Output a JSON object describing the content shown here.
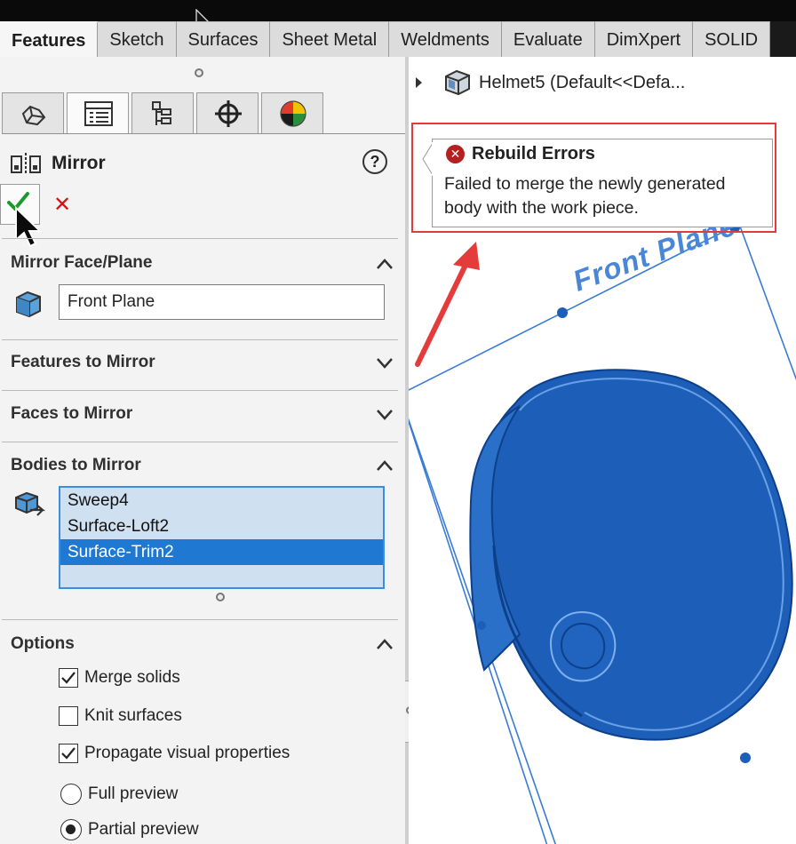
{
  "ribbon": {
    "tabs": [
      {
        "label": "Features",
        "active": true
      },
      {
        "label": "Sketch",
        "active": false
      },
      {
        "label": "Surfaces",
        "active": false
      },
      {
        "label": "Sheet Metal",
        "active": false
      },
      {
        "label": "Weldments",
        "active": false
      },
      {
        "label": "Evaluate",
        "active": false
      },
      {
        "label": "DimXpert",
        "active": false
      },
      {
        "label": "SOLID",
        "active": false
      }
    ]
  },
  "panel_tabs": [
    {
      "icon": "feature-manager-icon"
    },
    {
      "icon": "property-manager-icon"
    },
    {
      "icon": "configuration-manager-icon"
    },
    {
      "icon": "dimxpert-manager-icon"
    },
    {
      "icon": "display-manager-icon"
    }
  ],
  "property_manager": {
    "title": "Mirror",
    "help_label": "?",
    "ok_icon": "checkmark-icon",
    "cancel_label": "✕"
  },
  "sections": {
    "mirror_face_plane": {
      "title": "Mirror Face/Plane",
      "value": "Front Plane",
      "expanded": true
    },
    "features_to_mirror": {
      "title": "Features to Mirror",
      "expanded": false
    },
    "faces_to_mirror": {
      "title": "Faces to Mirror",
      "expanded": false
    },
    "bodies_to_mirror": {
      "title": "Bodies to Mirror",
      "expanded": true,
      "items": [
        "Sweep4",
        "Surface-Loft2",
        "Surface-Trim2"
      ],
      "selected_index": 2
    },
    "options": {
      "title": "Options",
      "expanded": true,
      "checkboxes": [
        {
          "label": "Merge solids",
          "checked": true
        },
        {
          "label": "Knit surfaces",
          "checked": false
        },
        {
          "label": "Propagate visual properties",
          "checked": true
        }
      ],
      "radios": [
        {
          "label": "Full preview",
          "selected": false
        },
        {
          "label": "Partial preview",
          "selected": true
        }
      ]
    }
  },
  "viewport": {
    "tree_root": "Helmet5  (Default<<Defa...",
    "error_tooltip": {
      "title": "Rebuild Errors",
      "message": "Failed to merge the newly generated body with the work piece."
    },
    "plane_label": "Front Plane"
  },
  "colors": {
    "error_outline": "#e43b3b",
    "plane_blue": "#3a7bd5",
    "model_blue": "#1d5fb8",
    "selection_blue": "#1f78d1"
  }
}
